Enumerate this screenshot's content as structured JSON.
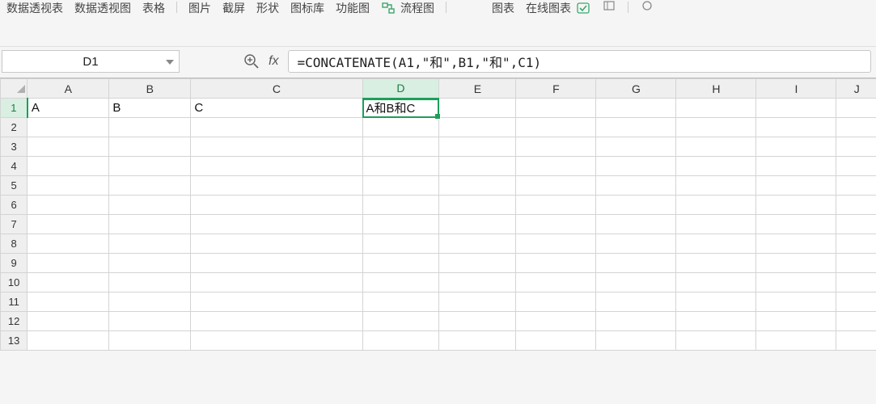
{
  "ribbon": {
    "items": [
      "数据透视表",
      "数据透视图",
      "表格",
      "图片",
      "截屏",
      "形状",
      "图标库",
      "功能图",
      "流程图",
      "图表",
      "在线图表"
    ]
  },
  "name_box": {
    "value": "D1"
  },
  "formula": {
    "text": "=CONCATENATE(A1,\"和\",B1,\"和\",C1)"
  },
  "columns": [
    "A",
    "B",
    "C",
    "D",
    "E",
    "F",
    "G",
    "H",
    "I",
    "J"
  ],
  "rows": [
    "1",
    "2",
    "3",
    "4",
    "5",
    "6",
    "7",
    "8",
    "9",
    "10",
    "11",
    "12",
    "13"
  ],
  "active": {
    "col": "D",
    "row": "1"
  },
  "cells": {
    "A1": "A",
    "B1": "B",
    "C1": "C",
    "D1": "A和B和C"
  }
}
